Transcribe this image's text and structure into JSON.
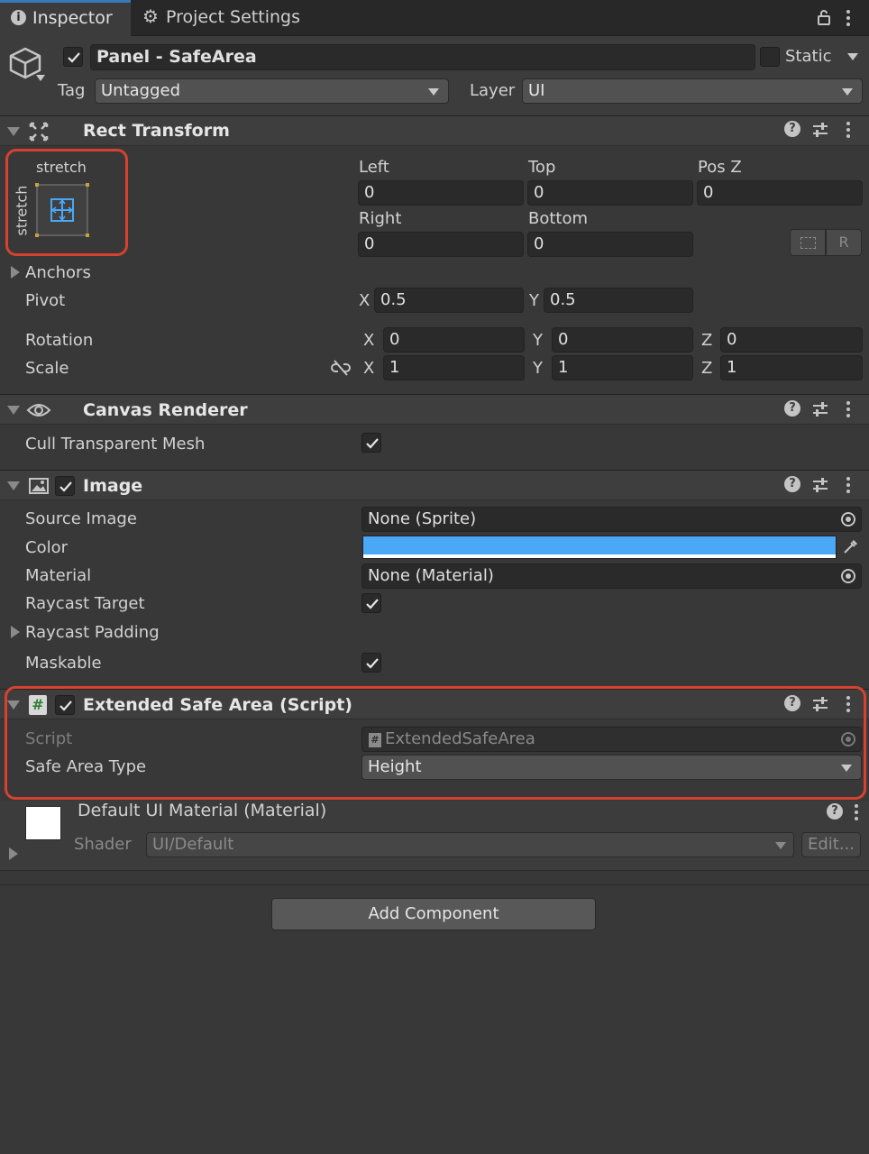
{
  "tabs": [
    {
      "label": "Inspector",
      "icon": "info-icon"
    },
    {
      "label": "Project Settings",
      "icon": "gear-icon"
    }
  ],
  "object": {
    "name": "Panel - SafeArea",
    "active": true,
    "static_label": "Static",
    "tag_label": "Tag",
    "tag_value": "Untagged",
    "layer_label": "Layer",
    "layer_value": "UI"
  },
  "rect_transform": {
    "title": "Rect Transform",
    "anchor_preset_h": "stretch",
    "anchor_preset_v": "stretch",
    "left_label": "Left",
    "left": "0",
    "top_label": "Top",
    "top": "0",
    "posz_label": "Pos Z",
    "posz": "0",
    "right_label": "Right",
    "right": "0",
    "bottom_label": "Bottom",
    "bottom": "0",
    "r_button": "R",
    "anchors_label": "Anchors",
    "pivot_label": "Pivot",
    "pivot_x": "0.5",
    "pivot_y": "0.5",
    "rotation_label": "Rotation",
    "rot_x": "0",
    "rot_y": "0",
    "rot_z": "0",
    "scale_label": "Scale",
    "scale_x": "1",
    "scale_y": "1",
    "scale_z": "1",
    "axis_x": "X",
    "axis_y": "Y",
    "axis_z": "Z"
  },
  "canvas_renderer": {
    "title": "Canvas Renderer",
    "cull_label": "Cull Transparent Mesh",
    "cull": true
  },
  "image": {
    "title": "Image",
    "enabled": true,
    "source_label": "Source Image",
    "source_value": "None (Sprite)",
    "color_label": "Color",
    "color_value": "#4aa8f6",
    "material_label": "Material",
    "material_value": "None (Material)",
    "raycast_label": "Raycast Target",
    "raycast": true,
    "padding_label": "Raycast Padding",
    "maskable_label": "Maskable",
    "maskable": true
  },
  "script_comp": {
    "title": "Extended Safe Area (Script)",
    "enabled": true,
    "script_label": "Script",
    "script_value": "ExtendedSafeArea",
    "type_label": "Safe Area Type",
    "type_value": "Height"
  },
  "material": {
    "title": "Default UI Material (Material)",
    "shader_label": "Shader",
    "shader_value": "UI/Default",
    "edit_label": "Edit..."
  },
  "add_component": "Add Component",
  "colors": {
    "highlight": "#d8412f",
    "accent": "#4aa8f6"
  }
}
